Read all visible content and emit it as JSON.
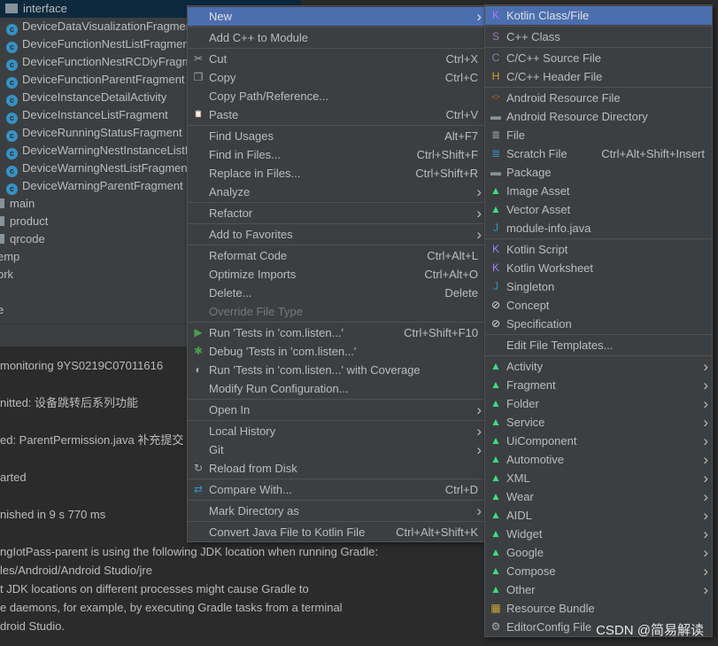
{
  "tree": {
    "selected": "interface",
    "items": [
      {
        "label": "DeviceDataVisualizationFragment",
        "kind": "class"
      },
      {
        "label": "DeviceFunctionNestListFragment",
        "kind": "class"
      },
      {
        "label": "DeviceFunctionNestRCDiyFragment",
        "kind": "class"
      },
      {
        "label": "DeviceFunctionParentFragment",
        "kind": "class"
      },
      {
        "label": "DeviceInstanceDetailActivity",
        "kind": "class"
      },
      {
        "label": "DeviceInstanceListFragment",
        "kind": "class"
      },
      {
        "label": "DeviceRunningStatusFragment",
        "kind": "class"
      },
      {
        "label": "DeviceWarningNestInstanceListFragment",
        "kind": "class"
      },
      {
        "label": "DeviceWarningNestListFragment",
        "kind": "class"
      },
      {
        "label": "DeviceWarningParentFragment",
        "kind": "class"
      },
      {
        "label": "main",
        "kind": "folder"
      },
      {
        "label": "product",
        "kind": "folder"
      },
      {
        "label": "qrcode",
        "kind": "folder"
      },
      {
        "label": "emp",
        "kind": "folder-cut"
      },
      {
        "label": "ork",
        "kind": "folder-cut"
      },
      {
        "label": "",
        "kind": "blank"
      },
      {
        "label": "e",
        "kind": "folder-cut"
      }
    ]
  },
  "console": [
    {
      "text": " monitoring 9YS0219C07011616"
    },
    {
      "text": "nitted: 设备跳转后系列功能"
    },
    {
      "text": "ed: ParentPermission.java 补充提交"
    },
    {
      "text": "arted"
    },
    {
      "text": "nished in 9 s 770 ms"
    },
    {
      "text": "ngIotPass-parent is using the following JDK location when running Gradle:"
    },
    {
      "text": "les/Android/Android Studio/jre"
    },
    {
      "text": "t JDK locations on different processes might cause Gradle to"
    },
    {
      "text": "e daemons, for example, by executing Gradle tasks from a terminal"
    },
    {
      "text": "droid Studio."
    }
  ],
  "context_menu": [
    {
      "label": "New",
      "submenu": true,
      "highlighted": true
    },
    {
      "sep": true
    },
    {
      "label": "Add C++ to Module"
    },
    {
      "sep": true
    },
    {
      "label": "Cut",
      "shortcut": "Ctrl+X",
      "icon": "scissors-icon",
      "glyph": "✂"
    },
    {
      "label": "Copy",
      "shortcut": "Ctrl+C",
      "icon": "copy-icon",
      "glyph": "❐"
    },
    {
      "label": "Copy Path/Reference..."
    },
    {
      "label": "Paste",
      "shortcut": "Ctrl+V",
      "icon": "clipboard-icon",
      "glyph": "📋"
    },
    {
      "sep": true
    },
    {
      "label": "Find Usages",
      "shortcut": "Alt+F7"
    },
    {
      "label": "Find in Files...",
      "shortcut": "Ctrl+Shift+F"
    },
    {
      "label": "Replace in Files...",
      "shortcut": "Ctrl+Shift+R"
    },
    {
      "label": "Analyze",
      "submenu": true
    },
    {
      "sep": true
    },
    {
      "label": "Refactor",
      "submenu": true
    },
    {
      "sep": true
    },
    {
      "label": "Add to Favorites",
      "submenu": true
    },
    {
      "sep": true
    },
    {
      "label": "Reformat Code",
      "shortcut": "Ctrl+Alt+L"
    },
    {
      "label": "Optimize Imports",
      "shortcut": "Ctrl+Alt+O"
    },
    {
      "label": "Delete...",
      "shortcut": "Delete"
    },
    {
      "label": "Override File Type",
      "disabled": true
    },
    {
      "sep": true
    },
    {
      "label": "Run 'Tests in 'com.listen...'",
      "shortcut": "Ctrl+Shift+F10",
      "icon": "run-icon",
      "glyph": "▶",
      "color": "#499c54"
    },
    {
      "label": "Debug 'Tests in 'com.listen...'",
      "icon": "debug-bug-icon",
      "glyph": "✱",
      "color": "#499c54"
    },
    {
      "label": "Run 'Tests in 'com.listen...' with Coverage",
      "icon": "coverage-icon",
      "glyph": "◐",
      "color": "#aaaaaa"
    },
    {
      "label": "Modify Run Configuration..."
    },
    {
      "sep": true
    },
    {
      "label": "Open In",
      "submenu": true
    },
    {
      "sep": true
    },
    {
      "label": "Local History",
      "submenu": true
    },
    {
      "label": "Git",
      "submenu": true
    },
    {
      "label": "Reload from Disk",
      "icon": "reload-icon",
      "glyph": "↻",
      "color": "#aaaaaa"
    },
    {
      "sep": true
    },
    {
      "label": "Compare With...",
      "shortcut": "Ctrl+D",
      "icon": "compare-icon",
      "glyph": "⇄",
      "color": "#3592c4"
    },
    {
      "sep": true
    },
    {
      "label": "Mark Directory as",
      "submenu": true
    },
    {
      "sep": true
    },
    {
      "label": "Convert Java File to Kotlin File",
      "shortcut": "Ctrl+Alt+Shift+K"
    }
  ],
  "new_submenu": [
    {
      "label": "Kotlin Class/File",
      "highlighted": true,
      "icon": "kotlin-file-icon",
      "glyph": "K",
      "color": "#a97bff"
    },
    {
      "sep": true
    },
    {
      "label": "C++ Class",
      "icon": "cpp-class-icon",
      "glyph": "S",
      "color": "#9876aa"
    },
    {
      "sep": true
    },
    {
      "label": "C/C++ Source File",
      "icon": "cpp-source-icon",
      "glyph": "C",
      "color": "#9876aa"
    },
    {
      "label": "C/C++ Header File",
      "icon": "cpp-header-icon",
      "glyph": "H",
      "color": "#d19a32"
    },
    {
      "sep": true
    },
    {
      "label": "Android Resource File",
      "icon": "android-resource-file-icon",
      "glyph": "<>",
      "color": "#cc5a1e"
    },
    {
      "label": "Android Resource Directory",
      "icon": "folder-icon",
      "glyph": "▬",
      "color": "#87939a"
    },
    {
      "label": "File",
      "icon": "file-icon",
      "glyph": "≣",
      "color": "#aaaaaa"
    },
    {
      "label": "Scratch File",
      "shortcut": "Ctrl+Alt+Shift+Insert",
      "icon": "scratch-file-icon",
      "glyph": "≣",
      "color": "#3592c4"
    },
    {
      "label": "Package",
      "icon": "package-icon",
      "glyph": "▬",
      "color": "#87939a"
    },
    {
      "label": "Image Asset",
      "icon": "android-icon",
      "glyph": "▲",
      "color": "#3ddc84"
    },
    {
      "label": "Vector Asset",
      "icon": "android-icon",
      "glyph": "▲",
      "color": "#3ddc84"
    },
    {
      "label": "module-info.java",
      "icon": "java-file-icon",
      "glyph": "J",
      "color": "#3592c4"
    },
    {
      "sep": true
    },
    {
      "label": "Kotlin Script",
      "icon": "kotlin-script-icon",
      "glyph": "K",
      "color": "#a97bff"
    },
    {
      "label": "Kotlin Worksheet",
      "icon": "kotlin-worksheet-icon",
      "glyph": "K",
      "color": "#a97bff"
    },
    {
      "label": "Singleton",
      "icon": "java-file-icon",
      "glyph": "J",
      "color": "#3592c4"
    },
    {
      "label": "Concept",
      "icon": "concept-icon",
      "glyph": "⊘",
      "color": "#dddddd"
    },
    {
      "label": "Specification",
      "icon": "specification-icon",
      "glyph": "⊘",
      "color": "#dddddd"
    },
    {
      "sep": true
    },
    {
      "label": "Edit File Templates..."
    },
    {
      "sep": true
    },
    {
      "label": "Activity",
      "submenu": true,
      "icon": "android-icon",
      "glyph": "▲",
      "color": "#3ddc84"
    },
    {
      "label": "Fragment",
      "submenu": true,
      "icon": "android-icon",
      "glyph": "▲",
      "color": "#3ddc84"
    },
    {
      "label": "Folder",
      "submenu": true,
      "icon": "android-icon",
      "glyph": "▲",
      "color": "#3ddc84"
    },
    {
      "label": "Service",
      "submenu": true,
      "icon": "android-icon",
      "glyph": "▲",
      "color": "#3ddc84"
    },
    {
      "label": "UiComponent",
      "submenu": true,
      "icon": "android-icon",
      "glyph": "▲",
      "color": "#3ddc84"
    },
    {
      "label": "Automotive",
      "submenu": true,
      "icon": "android-icon",
      "glyph": "▲",
      "color": "#3ddc84"
    },
    {
      "label": "XML",
      "submenu": true,
      "icon": "android-icon",
      "glyph": "▲",
      "color": "#3ddc84"
    },
    {
      "label": "Wear",
      "submenu": true,
      "icon": "android-icon",
      "glyph": "▲",
      "color": "#3ddc84"
    },
    {
      "label": "AIDL",
      "submenu": true,
      "icon": "android-icon",
      "glyph": "▲",
      "color": "#3ddc84"
    },
    {
      "label": "Widget",
      "submenu": true,
      "icon": "android-icon",
      "glyph": "▲",
      "color": "#3ddc84"
    },
    {
      "label": "Google",
      "submenu": true,
      "icon": "android-icon",
      "glyph": "▲",
      "color": "#3ddc84"
    },
    {
      "label": "Compose",
      "submenu": true,
      "icon": "android-icon",
      "glyph": "▲",
      "color": "#3ddc84"
    },
    {
      "label": "Other",
      "submenu": true,
      "icon": "android-icon",
      "glyph": "▲",
      "color": "#3ddc84"
    },
    {
      "label": "Resource Bundle",
      "icon": "resource-bundle-icon",
      "glyph": "▦",
      "color": "#c9a13a"
    },
    {
      "label": "EditorConfig File",
      "icon": "gear-icon",
      "glyph": "⚙",
      "color": "#aaaaaa"
    }
  ],
  "watermark": "CSDN @简易解读",
  "colors": {
    "highlight": "#4b6eaf",
    "menu_bg": "#3c3f41",
    "console_bg": "#2b2b2b"
  }
}
